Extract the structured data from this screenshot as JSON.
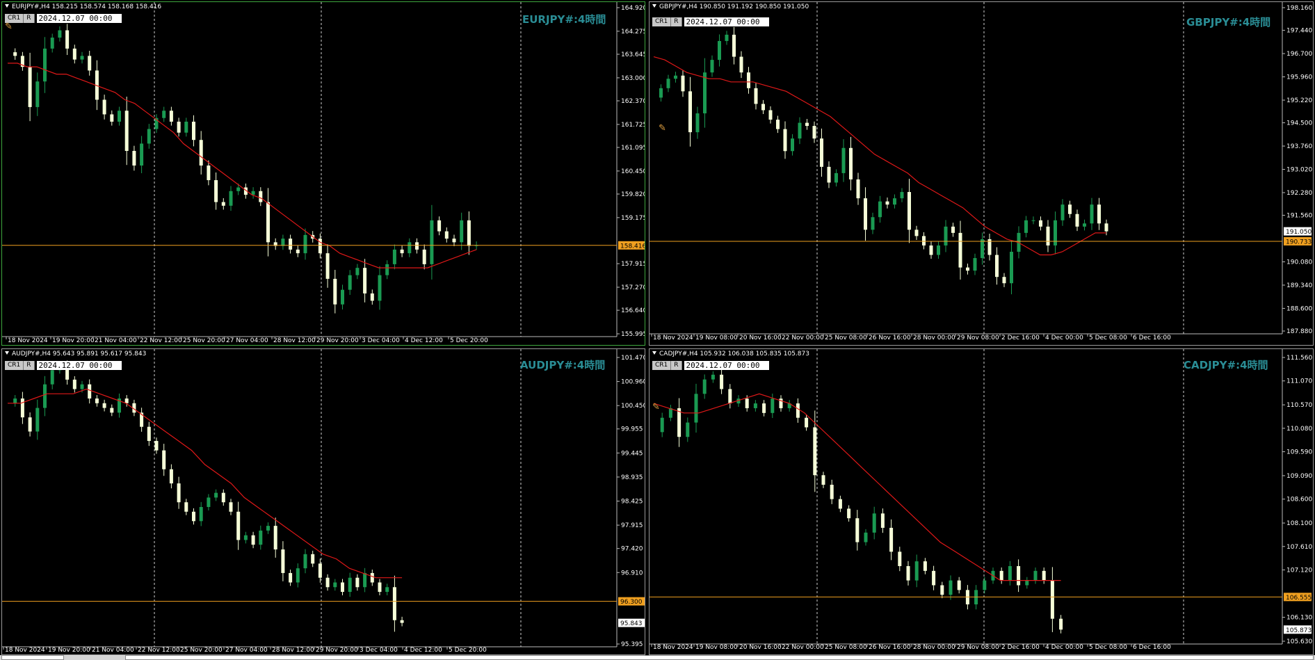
{
  "charts": [
    {
      "id": "eurjpy",
      "symbol_header": "EURJPY#,H4  158.215 158.574 158.168 158.416",
      "watermark": "EURJPY#:4時間",
      "buttons": [
        "CR1",
        "R"
      ],
      "date_box": "2024.12.07 00:00",
      "y_ticks": [
        "164.920",
        "164.275",
        "163.645",
        "163.000",
        "162.370",
        "161.725",
        "161.095",
        "160.450",
        "159.820",
        "159.175",
        "157.915",
        "157.270",
        "156.640",
        "155.995"
      ],
      "y_range": [
        155.995,
        164.92
      ],
      "x_ticks": [
        "18 Nov 2024",
        "19 Nov 20:00",
        "21 Nov 04:00",
        "22 Nov 12:00",
        "25 Nov 20:00",
        "27 Nov 04:00",
        "28 Nov 12:00",
        "29 Nov 20:00",
        "3 Dec 04:00",
        "4 Dec 12:00",
        "5 Dec 20:00"
      ],
      "current_price": "158.416",
      "current_value": 158.416,
      "ma_color": "#e01818",
      "price_line_color": "#f0a020",
      "closes": [
        163.7,
        163.6,
        163.3,
        162.2,
        162.9,
        163.8,
        164.1,
        164.3,
        163.8,
        163.5,
        163.6,
        163.2,
        162.4,
        162.0,
        161.8,
        162.1,
        161.0,
        160.6,
        161.2,
        161.6,
        161.9,
        162.1,
        161.8,
        161.5,
        161.8,
        161.3,
        160.6,
        160.2,
        159.6,
        159.5,
        159.9,
        160.0,
        159.8,
        159.9,
        159.6,
        158.5,
        158.4,
        158.6,
        158.3,
        158.2,
        158.7,
        158.6,
        158.2,
        157.5,
        156.8,
        157.2,
        157.6,
        157.8,
        157.1,
        156.9,
        157.6,
        157.9,
        158.3,
        158.2,
        158.5,
        158.3,
        157.9,
        159.1,
        158.8,
        158.6,
        158.5,
        159.1,
        158.4,
        158.416
      ],
      "ma": [
        163.4,
        163.4,
        163.3,
        163.3,
        163.2,
        163.1,
        163.1,
        163.0,
        162.9,
        162.8,
        162.7,
        162.6,
        162.4,
        162.3,
        162.1,
        161.9,
        161.7,
        161.5,
        161.2,
        161.0,
        160.8,
        160.6,
        160.4,
        160.2,
        160.0,
        159.8,
        159.7,
        159.5,
        159.3,
        159.1,
        158.9,
        158.7,
        158.5,
        158.4,
        158.2,
        158.1,
        158.0,
        157.9,
        157.8,
        157.8,
        157.8,
        157.8,
        157.8,
        157.8,
        157.9,
        158.0,
        158.1,
        158.2,
        158.3
      ]
    },
    {
      "id": "gbpjpy",
      "symbol_header": "GBPJPY#,H4  190.850 191.192 190.850 191.050",
      "watermark": "GBPJPY#:4時間",
      "buttons": [
        "CR1",
        "R"
      ],
      "date_box": "2024.12.07 00:00",
      "y_ticks": [
        "198.160",
        "197.440",
        "196.700",
        "195.960",
        "195.220",
        "194.500",
        "193.760",
        "193.020",
        "192.280",
        "191.560",
        "190.080",
        "189.340",
        "188.600",
        "187.880"
      ],
      "y_range": [
        187.88,
        198.16
      ],
      "x_ticks": [
        "18 Nov 2024",
        "19 Nov 08:00",
        "20 Nov 16:00",
        "22 Nov 00:00",
        "25 Nov 08:00",
        "26 Nov 16:00",
        "28 Nov 00:00",
        "29 Nov 08:00",
        "2 Dec 16:00",
        "4 Dec 00:00",
        "5 Dec 08:00",
        "6 Dec 16:00"
      ],
      "current_price": "190.733",
      "current_value": 190.733,
      "last_price": "191.050",
      "last_value": 191.05,
      "ma_color": "#e01818",
      "price_line_color": "#f0a020",
      "closes": [
        195.3,
        195.6,
        195.9,
        196.0,
        195.5,
        194.2,
        194.8,
        196.1,
        196.5,
        197.1,
        197.3,
        196.6,
        196.1,
        195.6,
        195.1,
        194.9,
        194.6,
        194.3,
        193.6,
        194.0,
        194.5,
        194.4,
        194.0,
        193.1,
        192.6,
        192.9,
        193.7,
        192.7,
        192.1,
        191.1,
        191.5,
        192.0,
        191.9,
        192.1,
        192.3,
        191.1,
        190.9,
        190.6,
        190.3,
        190.6,
        191.2,
        191.0,
        189.9,
        189.8,
        190.2,
        190.8,
        190.3,
        189.6,
        189.4,
        190.4,
        191.0,
        191.4,
        191.4,
        191.2,
        190.6,
        191.4,
        191.9,
        191.6,
        191.2,
        191.3,
        191.9,
        191.3,
        191.05
      ],
      "ma": [
        196.6,
        196.5,
        196.3,
        196.1,
        196.0,
        195.9,
        195.9,
        195.8,
        195.8,
        195.8,
        195.7,
        195.6,
        195.5,
        195.3,
        195.1,
        194.9,
        194.7,
        194.4,
        194.1,
        193.8,
        193.5,
        193.3,
        193.1,
        192.9,
        192.6,
        192.4,
        192.2,
        192.0,
        191.8,
        191.5,
        191.2,
        191.0,
        190.8,
        190.7,
        190.5,
        190.3,
        190.3,
        190.4,
        190.6,
        190.8,
        191.0,
        191.0
      ]
    },
    {
      "id": "audjpy",
      "symbol_header": "AUDJPY#,H4  95.643 95.891 95.617 95.843",
      "watermark": "AUDJPY#:4時間",
      "buttons": [
        "CR1",
        "R"
      ],
      "date_box": "2024.12.07 00:00",
      "y_ticks": [
        "101.470",
        "100.960",
        "100.450",
        "99.955",
        "99.445",
        "98.935",
        "98.425",
        "97.915",
        "97.420",
        "96.910",
        "95.395"
      ],
      "y_range": [
        95.395,
        101.47
      ],
      "x_ticks": [
        "18 Nov 2024",
        "19 Nov 20:00",
        "21 Nov 04:00",
        "22 Nov 12:00",
        "25 Nov 20:00",
        "27 Nov 04:00",
        "28 Nov 12:00",
        "29 Nov 20:00",
        "3 Dec 04:00",
        "4 Dec 12:00",
        "5 Dec 20:00"
      ],
      "current_price": "96.300",
      "current_value": 96.3,
      "last_price": "95.843",
      "last_value": 95.843,
      "ma_color": "#e01818",
      "price_line_color": "#f0a020",
      "closes": [
        100.5,
        100.6,
        100.2,
        99.9,
        100.4,
        100.9,
        101.2,
        101.3,
        101.0,
        100.8,
        100.9,
        100.6,
        100.5,
        100.4,
        100.3,
        100.6,
        100.5,
        100.3,
        100.0,
        99.7,
        99.5,
        99.1,
        98.8,
        98.4,
        98.2,
        98.0,
        98.3,
        98.5,
        98.6,
        98.4,
        98.2,
        97.6,
        97.7,
        97.5,
        97.8,
        97.9,
        97.4,
        96.9,
        96.7,
        97.0,
        97.3,
        97.1,
        96.8,
        96.6,
        96.7,
        96.5,
        96.8,
        96.6,
        96.9,
        96.7,
        96.5,
        96.6,
        95.9,
        95.843
      ],
      "ma": [
        100.5,
        100.5,
        100.6,
        100.7,
        100.7,
        100.7,
        100.8,
        100.7,
        100.6,
        100.5,
        100.3,
        100.1,
        99.9,
        99.7,
        99.5,
        99.2,
        99.0,
        98.8,
        98.5,
        98.3,
        98.1,
        97.9,
        97.7,
        97.5,
        97.3,
        97.2,
        97.0,
        96.9,
        96.8,
        96.8,
        96.8
      ]
    },
    {
      "id": "cadjpy",
      "symbol_header": "CADJPY#,H4  105.932 106.038 105.835 105.873",
      "watermark": "CADJPY#:4時間",
      "buttons": [
        "CR1",
        "R"
      ],
      "date_box": "2024.12.07 00:00",
      "y_ticks": [
        "111.560",
        "111.070",
        "110.570",
        "110.080",
        "109.590",
        "109.090",
        "108.600",
        "108.100",
        "107.610",
        "107.120",
        "106.130",
        "105.630"
      ],
      "y_range": [
        105.63,
        111.56
      ],
      "x_ticks": [
        "18 Nov 2024",
        "19 Nov 08:00",
        "20 Nov 16:00",
        "22 Nov 00:00",
        "25 Nov 08:00",
        "26 Nov 16:00",
        "28 Nov 00:00",
        "29 Nov 08:00",
        "2 Dec 16:00",
        "4 Dec 00:00",
        "5 Dec 08:00",
        "6 Dec 16:00"
      ],
      "current_price": "106.555",
      "current_value": 106.555,
      "last_price": "105.873",
      "last_value": 105.873,
      "ma_color": "#e01818",
      "price_line_color": "#f0a020",
      "closes": [
        110.0,
        110.3,
        110.5,
        109.9,
        110.2,
        110.8,
        111.1,
        111.2,
        110.9,
        110.6,
        110.7,
        110.5,
        110.6,
        110.4,
        110.7,
        110.5,
        110.6,
        110.3,
        110.1,
        109.1,
        108.9,
        108.6,
        108.4,
        108.2,
        107.7,
        107.9,
        108.3,
        108.0,
        107.5,
        107.2,
        106.9,
        107.3,
        107.1,
        106.8,
        106.6,
        106.9,
        106.7,
        106.4,
        106.7,
        106.9,
        107.1,
        106.9,
        107.2,
        106.8,
        106.9,
        107.1,
        106.9,
        106.1,
        105.873
      ],
      "ma": [
        110.6,
        110.5,
        110.4,
        110.4,
        110.5,
        110.6,
        110.7,
        110.8,
        110.7,
        110.6,
        110.4,
        110.1,
        109.8,
        109.5,
        109.2,
        108.9,
        108.6,
        108.3,
        108.0,
        107.7,
        107.5,
        107.3,
        107.1,
        106.9,
        106.9,
        106.9,
        106.9,
        106.9
      ]
    }
  ]
}
